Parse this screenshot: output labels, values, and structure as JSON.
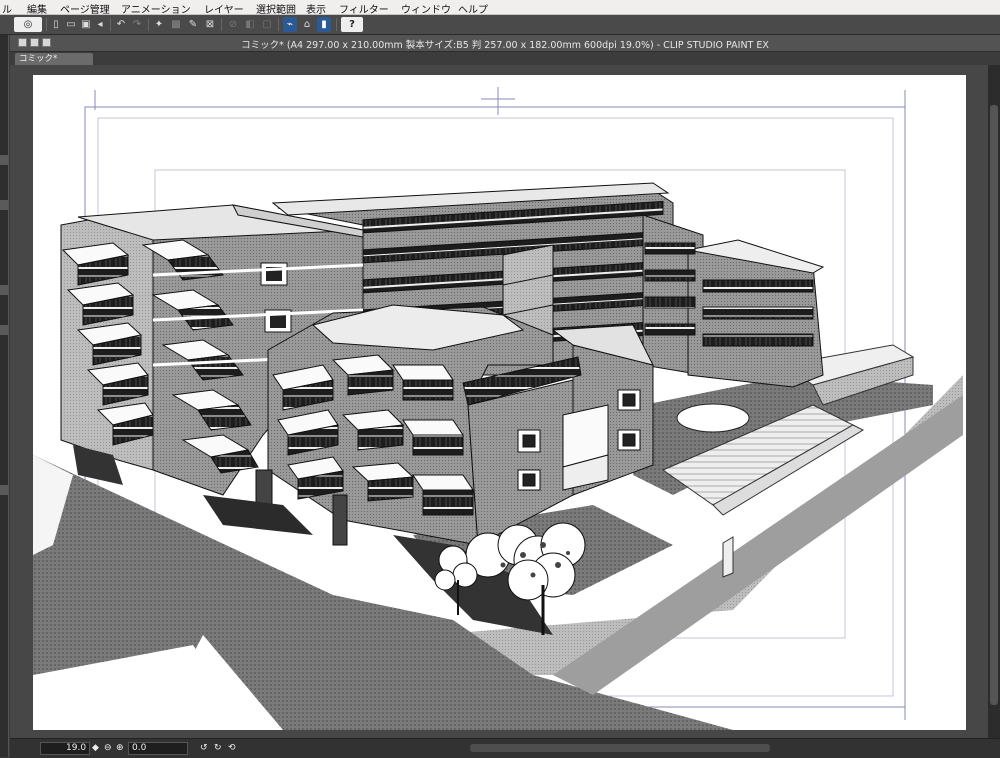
{
  "menu": {
    "items": [
      "ル",
      "編集",
      "ページ管理",
      "アニメーション",
      "レイヤー",
      "選択範囲",
      "表示",
      "フィルター",
      "ウィンドウ",
      "ヘルプ"
    ]
  },
  "toolbar": {
    "help_label": "?"
  },
  "window": {
    "title": "コミック* (A4 297.00 x 210.00mm 製本サイズ:B5 判 257.00 x 182.00mm 600dpi 19.0%)  - CLIP STUDIO PAINT EX",
    "tab_label": "コミック*"
  },
  "status": {
    "zoom": "19.0",
    "angle": "0.0"
  },
  "colors": {
    "menubar_bg": "#f1eeee",
    "toolbar_bg": "#4a4a4a",
    "canvas_bg": "#474747",
    "page_bg": "#ffffff",
    "guide_color": "#8a8ab8"
  }
}
